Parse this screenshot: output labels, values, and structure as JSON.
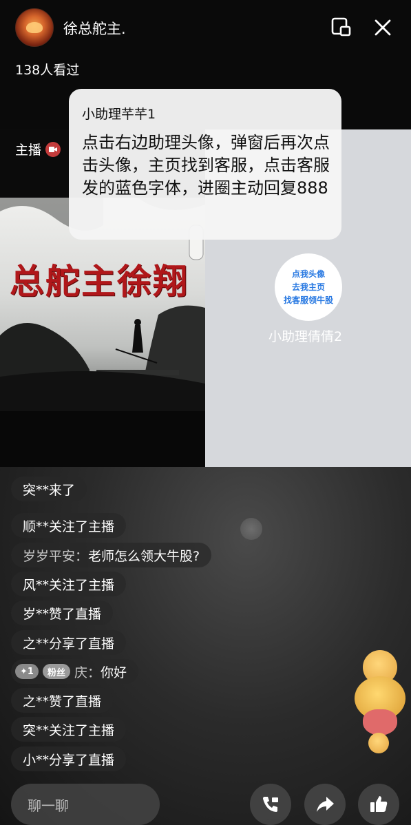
{
  "header": {
    "host_name": "徐总舵主.",
    "viewers": "138人看过"
  },
  "anchor": {
    "label": "主播"
  },
  "bubble": {
    "name": "小助理芊芊1",
    "text": "点击右边助理头像，弹窗后再次点击头像，主页找到客服，点击客服发的蓝色字体，进圈主动回复888"
  },
  "poster": {
    "title": "总舵主徐翔"
  },
  "assistant": {
    "avatar_lines": [
      "点我头像",
      "去我主页",
      "找客服领牛股"
    ],
    "name": "小助理倩倩2"
  },
  "chat": {
    "messages": [
      {
        "user": "突**",
        "text": " 来了"
      },
      {
        "user": "顺**",
        "text": " 关注了主播"
      },
      {
        "user": "岁岁平安：",
        "text": "老师怎么领大牛股?"
      },
      {
        "user": "风**",
        "text": " 关注了主播"
      },
      {
        "user": "岁**",
        "text": " 赞了直播"
      },
      {
        "user": "之**",
        "text": " 分享了直播"
      },
      {
        "badge1": "✦1",
        "badge2": "粉丝",
        "user": "庆：",
        "text": "你好"
      },
      {
        "user": "之**",
        "text": " 赞了直播"
      },
      {
        "user": "突**",
        "text": " 关注了主播"
      },
      {
        "user": "小**",
        "text": " 分享了直播"
      }
    ]
  },
  "bottom": {
    "input_placeholder": "聊一聊"
  },
  "icons": {
    "window": "picture-in-picture-icon",
    "close": "close-icon",
    "call": "call-icon",
    "share": "share-icon",
    "like": "thumbs-up-icon"
  },
  "colors": {
    "assistant_text": "#2a7ae2",
    "poster_title": "#b0171a"
  }
}
